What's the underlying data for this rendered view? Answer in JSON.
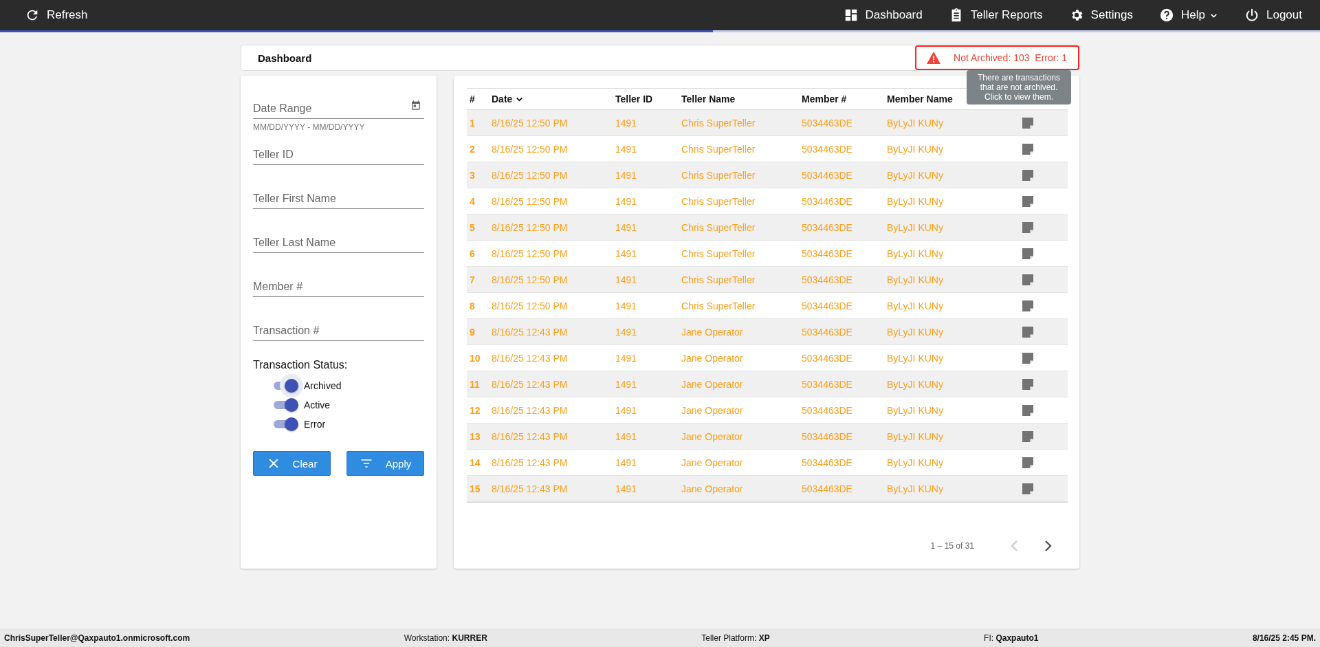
{
  "topbar": {
    "refresh": "Refresh",
    "items": [
      {
        "label": "Dashboard",
        "dropdown": false
      },
      {
        "label": "Teller Reports",
        "dropdown": false
      },
      {
        "label": "Settings",
        "dropdown": false
      },
      {
        "label": "Help",
        "dropdown": true
      },
      {
        "label": "Logout",
        "dropdown": false
      }
    ]
  },
  "loading_bar": {
    "level": 0.54
  },
  "page_title": "Dashboard",
  "alert": {
    "text": "Not Archived: 103  Error: 1",
    "tooltip": "There are transactions that are not archived. Click to view them."
  },
  "filters": {
    "fields": [
      {
        "placeholder": "Date Range",
        "kind": "date",
        "hint": "MM/DD/YYYY - MM/DD/YYYY"
      },
      {
        "placeholder": "Teller ID",
        "kind": "text"
      },
      {
        "placeholder": "Teller First Name",
        "kind": "text"
      },
      {
        "placeholder": "Teller Last Name",
        "kind": "text"
      },
      {
        "placeholder": "Member #",
        "kind": "text"
      },
      {
        "placeholder": "Transaction #",
        "kind": "text"
      }
    ],
    "status_label": "Transaction Status:",
    "statuses": [
      {
        "label": "Archived",
        "on": true,
        "focused": true
      },
      {
        "label": "Active",
        "on": true,
        "focused": false
      },
      {
        "label": "Error",
        "on": true,
        "focused": false
      }
    ],
    "buttons": [
      {
        "label": "Clear",
        "kind": "clear"
      },
      {
        "label": "Apply",
        "kind": "apply"
      }
    ]
  },
  "table": {
    "columns": [
      {
        "label": "#",
        "sorted": false
      },
      {
        "label": "Date",
        "sorted": true
      },
      {
        "label": "Teller ID",
        "sorted": false
      },
      {
        "label": "Teller Name",
        "sorted": false
      },
      {
        "label": "Member #",
        "sorted": false
      },
      {
        "label": "Member Name",
        "sorted": false
      }
    ],
    "rows": [
      [
        "1",
        "8/16/25 12:50 PM",
        "1491",
        "Chris SuperTeller",
        "5034463DE",
        "ByLyJI KUNy"
      ],
      [
        "2",
        "8/16/25 12:50 PM",
        "1491",
        "Chris SuperTeller",
        "5034463DE",
        "ByLyJI KUNy"
      ],
      [
        "3",
        "8/16/25 12:50 PM",
        "1491",
        "Chris SuperTeller",
        "5034463DE",
        "ByLyJI KUNy"
      ],
      [
        "4",
        "8/16/25 12:50 PM",
        "1491",
        "Chris SuperTeller",
        "5034463DE",
        "ByLyJI KUNy"
      ],
      [
        "5",
        "8/16/25 12:50 PM",
        "1491",
        "Chris SuperTeller",
        "5034463DE",
        "ByLyJI KUNy"
      ],
      [
        "6",
        "8/16/25 12:50 PM",
        "1491",
        "Chris SuperTeller",
        "5034463DE",
        "ByLyJI KUNy"
      ],
      [
        "7",
        "8/16/25 12:50 PM",
        "1491",
        "Chris SuperTeller",
        "5034463DE",
        "ByLyJI KUNy"
      ],
      [
        "8",
        "8/16/25 12:50 PM",
        "1491",
        "Chris SuperTeller",
        "5034463DE",
        "ByLyJI KUNy"
      ],
      [
        "9",
        "8/16/25 12:43 PM",
        "1491",
        "Jane Operator",
        "5034463DE",
        "ByLyJI KUNy"
      ],
      [
        "10",
        "8/16/25 12:43 PM",
        "1491",
        "Jane Operator",
        "5034463DE",
        "ByLyJI KUNy"
      ],
      [
        "11",
        "8/16/25 12:43 PM",
        "1491",
        "Jane Operator",
        "5034463DE",
        "ByLyJI KUNy"
      ],
      [
        "12",
        "8/16/25 12:43 PM",
        "1491",
        "Jane Operator",
        "5034463DE",
        "ByLyJI KUNy"
      ],
      [
        "13",
        "8/16/25 12:43 PM",
        "1491",
        "Jane Operator",
        "5034463DE",
        "ByLyJI KUNy"
      ],
      [
        "14",
        "8/16/25 12:43 PM",
        "1491",
        "Jane Operator",
        "5034463DE",
        "ByLyJI KUNy"
      ],
      [
        "15",
        "8/16/25 12:43 PM",
        "1491",
        "Jane Operator",
        "5034463DE",
        "ByLyJI KUNy"
      ]
    ],
    "pagination": {
      "range": "1 – 15 of 31",
      "prev_disabled": true,
      "next_disabled": false
    }
  },
  "status_bar": {
    "user": "ChrisSuperTeller@Qaxpauto1.onmicrosoft.com",
    "workstation": "Workstation: **KURRER**",
    "platform": "Teller Platform: **XP**",
    "fi": "FI: **Qaxpauto1**",
    "datetime": "8/16/25 2:45 PM."
  }
}
